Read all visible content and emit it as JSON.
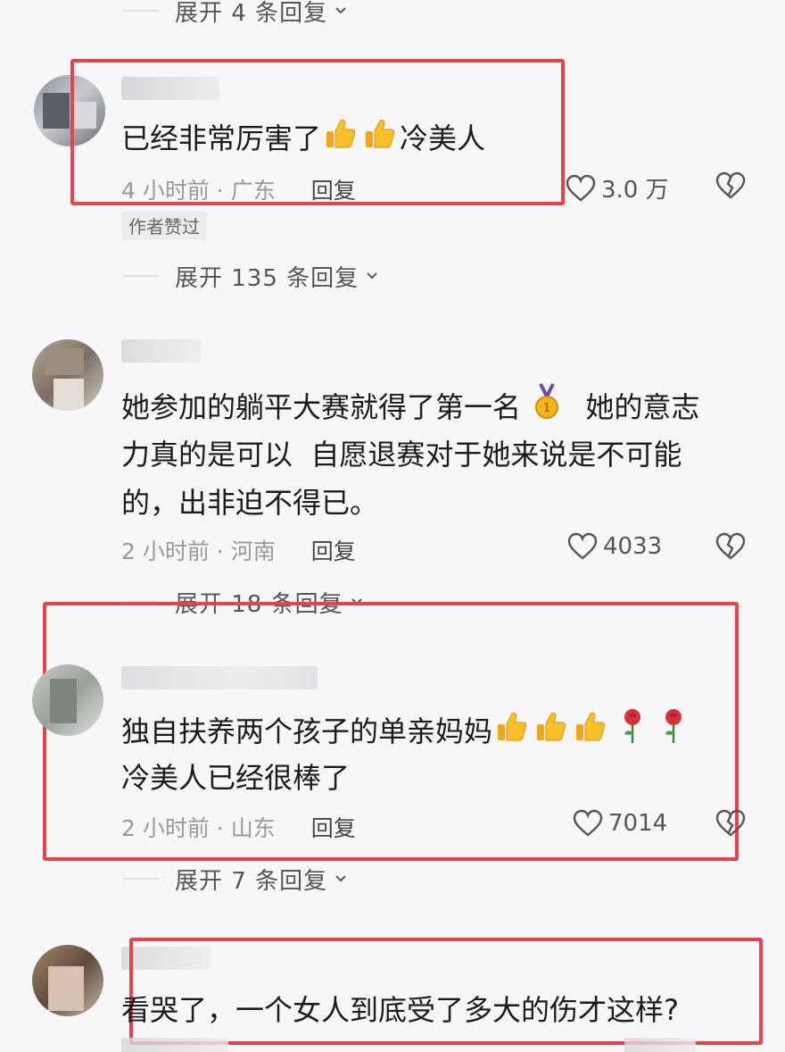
{
  "expand_top": {
    "label": "展开 4 条回复"
  },
  "comments": [
    {
      "text": "已经非常厉害了",
      "text_tail": "冷美人",
      "time_location": "4 小时前 · 广东",
      "reply": "回复",
      "likes": "3.0 万",
      "badge": "作者赞过",
      "expand": "展开 135 条回复"
    },
    {
      "line1": "她参加的躺平大赛就得了第一名",
      "line1_tail": "她的意志",
      "line2": "力真的是可以  自愿退赛对于她来说是不可能",
      "line3": "的，出非迫不得已。",
      "time_location": "2 小时前 · 河南",
      "reply": "回复",
      "likes": "4033",
      "expand": "展开 18 条回复"
    },
    {
      "line1": "独自扶养两个孩子的单亲妈妈",
      "line2": "冷美人已经很棒了",
      "time_location": "2 小时前 · 山东",
      "reply": "回复",
      "likes": "7014",
      "expand": "展开 7 条回复"
    },
    {
      "line1": "看哭了，一个女人到底受了多大的伤才这样?"
    }
  ],
  "colors": {
    "highlight_box": "#e8434a",
    "background": "#f7f7f9"
  },
  "icons": [
    "thumbs-up-emoji",
    "medal-emoji",
    "rose-emoji",
    "heart-icon",
    "broken-heart-icon",
    "chevron-down-icon"
  ]
}
